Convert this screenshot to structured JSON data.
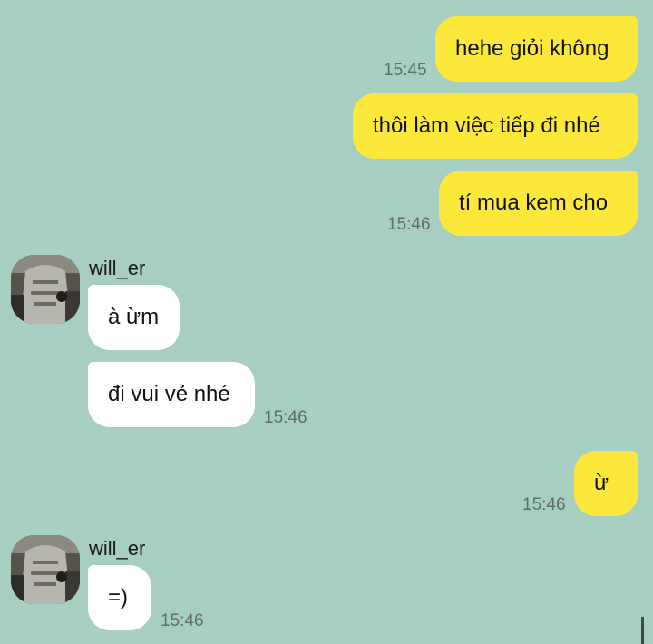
{
  "messages": [
    {
      "direction": "out",
      "text": "hehe giỏi không",
      "time": "15:45"
    },
    {
      "direction": "out",
      "text": "thôi làm việc tiếp đi nhé",
      "time": ""
    },
    {
      "direction": "out",
      "text": "tí mua kem cho",
      "time": "15:46"
    },
    {
      "direction": "in",
      "sender": "will_er",
      "text": "à ừm",
      "time": ""
    },
    {
      "direction": "in",
      "text": "đi vui vẻ nhé",
      "time": "15:46"
    },
    {
      "direction": "out",
      "text": "ừ",
      "time": "15:46"
    },
    {
      "direction": "in",
      "sender": "will_er",
      "text": "=)",
      "time": "15:46"
    }
  ],
  "colors": {
    "background": "#a6cfc2",
    "outgoing_bubble": "#fbe83b",
    "incoming_bubble": "#ffffff",
    "timestamp": "#5f6e68"
  },
  "icons": {
    "avatar": "user-avatar-photo"
  }
}
